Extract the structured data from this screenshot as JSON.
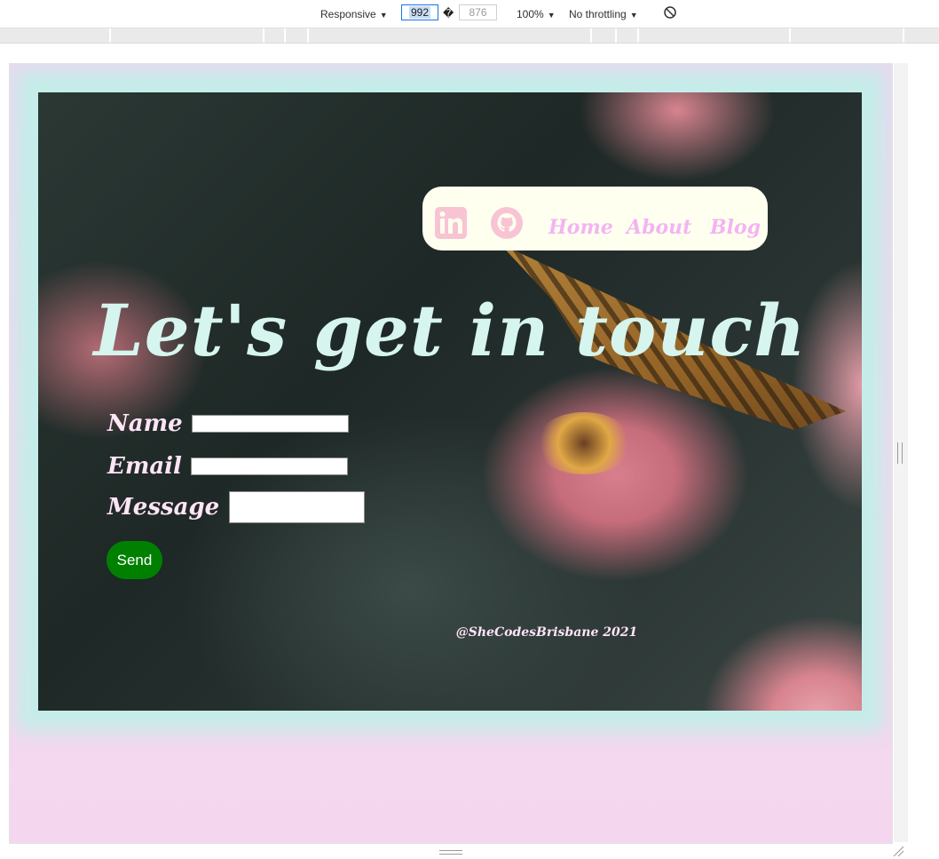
{
  "devtools": {
    "device_mode": "Responsive",
    "width_value": "992",
    "height_value": "876",
    "zoom": "100%",
    "throttling": "No throttling"
  },
  "nav": {
    "icons": [
      "linkedin-icon",
      "github-icon"
    ],
    "links": [
      "Home",
      "About",
      "Blog"
    ]
  },
  "hero": {
    "headline": "Let's get in touch"
  },
  "form": {
    "name_label": "Name",
    "email_label": "Email",
    "message_label": "Message",
    "send_label": "Send"
  },
  "footer": {
    "credit": "@SheCodesBrisbane 2021"
  },
  "colors": {
    "nav_bg": "#fffff0",
    "nav_link": "#f3b4f2",
    "icon_pink": "#f8c4d4",
    "headline": "#d5f5ee",
    "label": "#ffe4f6",
    "send_bg": "#008000",
    "glow": "#bef0e8",
    "page_bg": "#f4d7ef"
  }
}
